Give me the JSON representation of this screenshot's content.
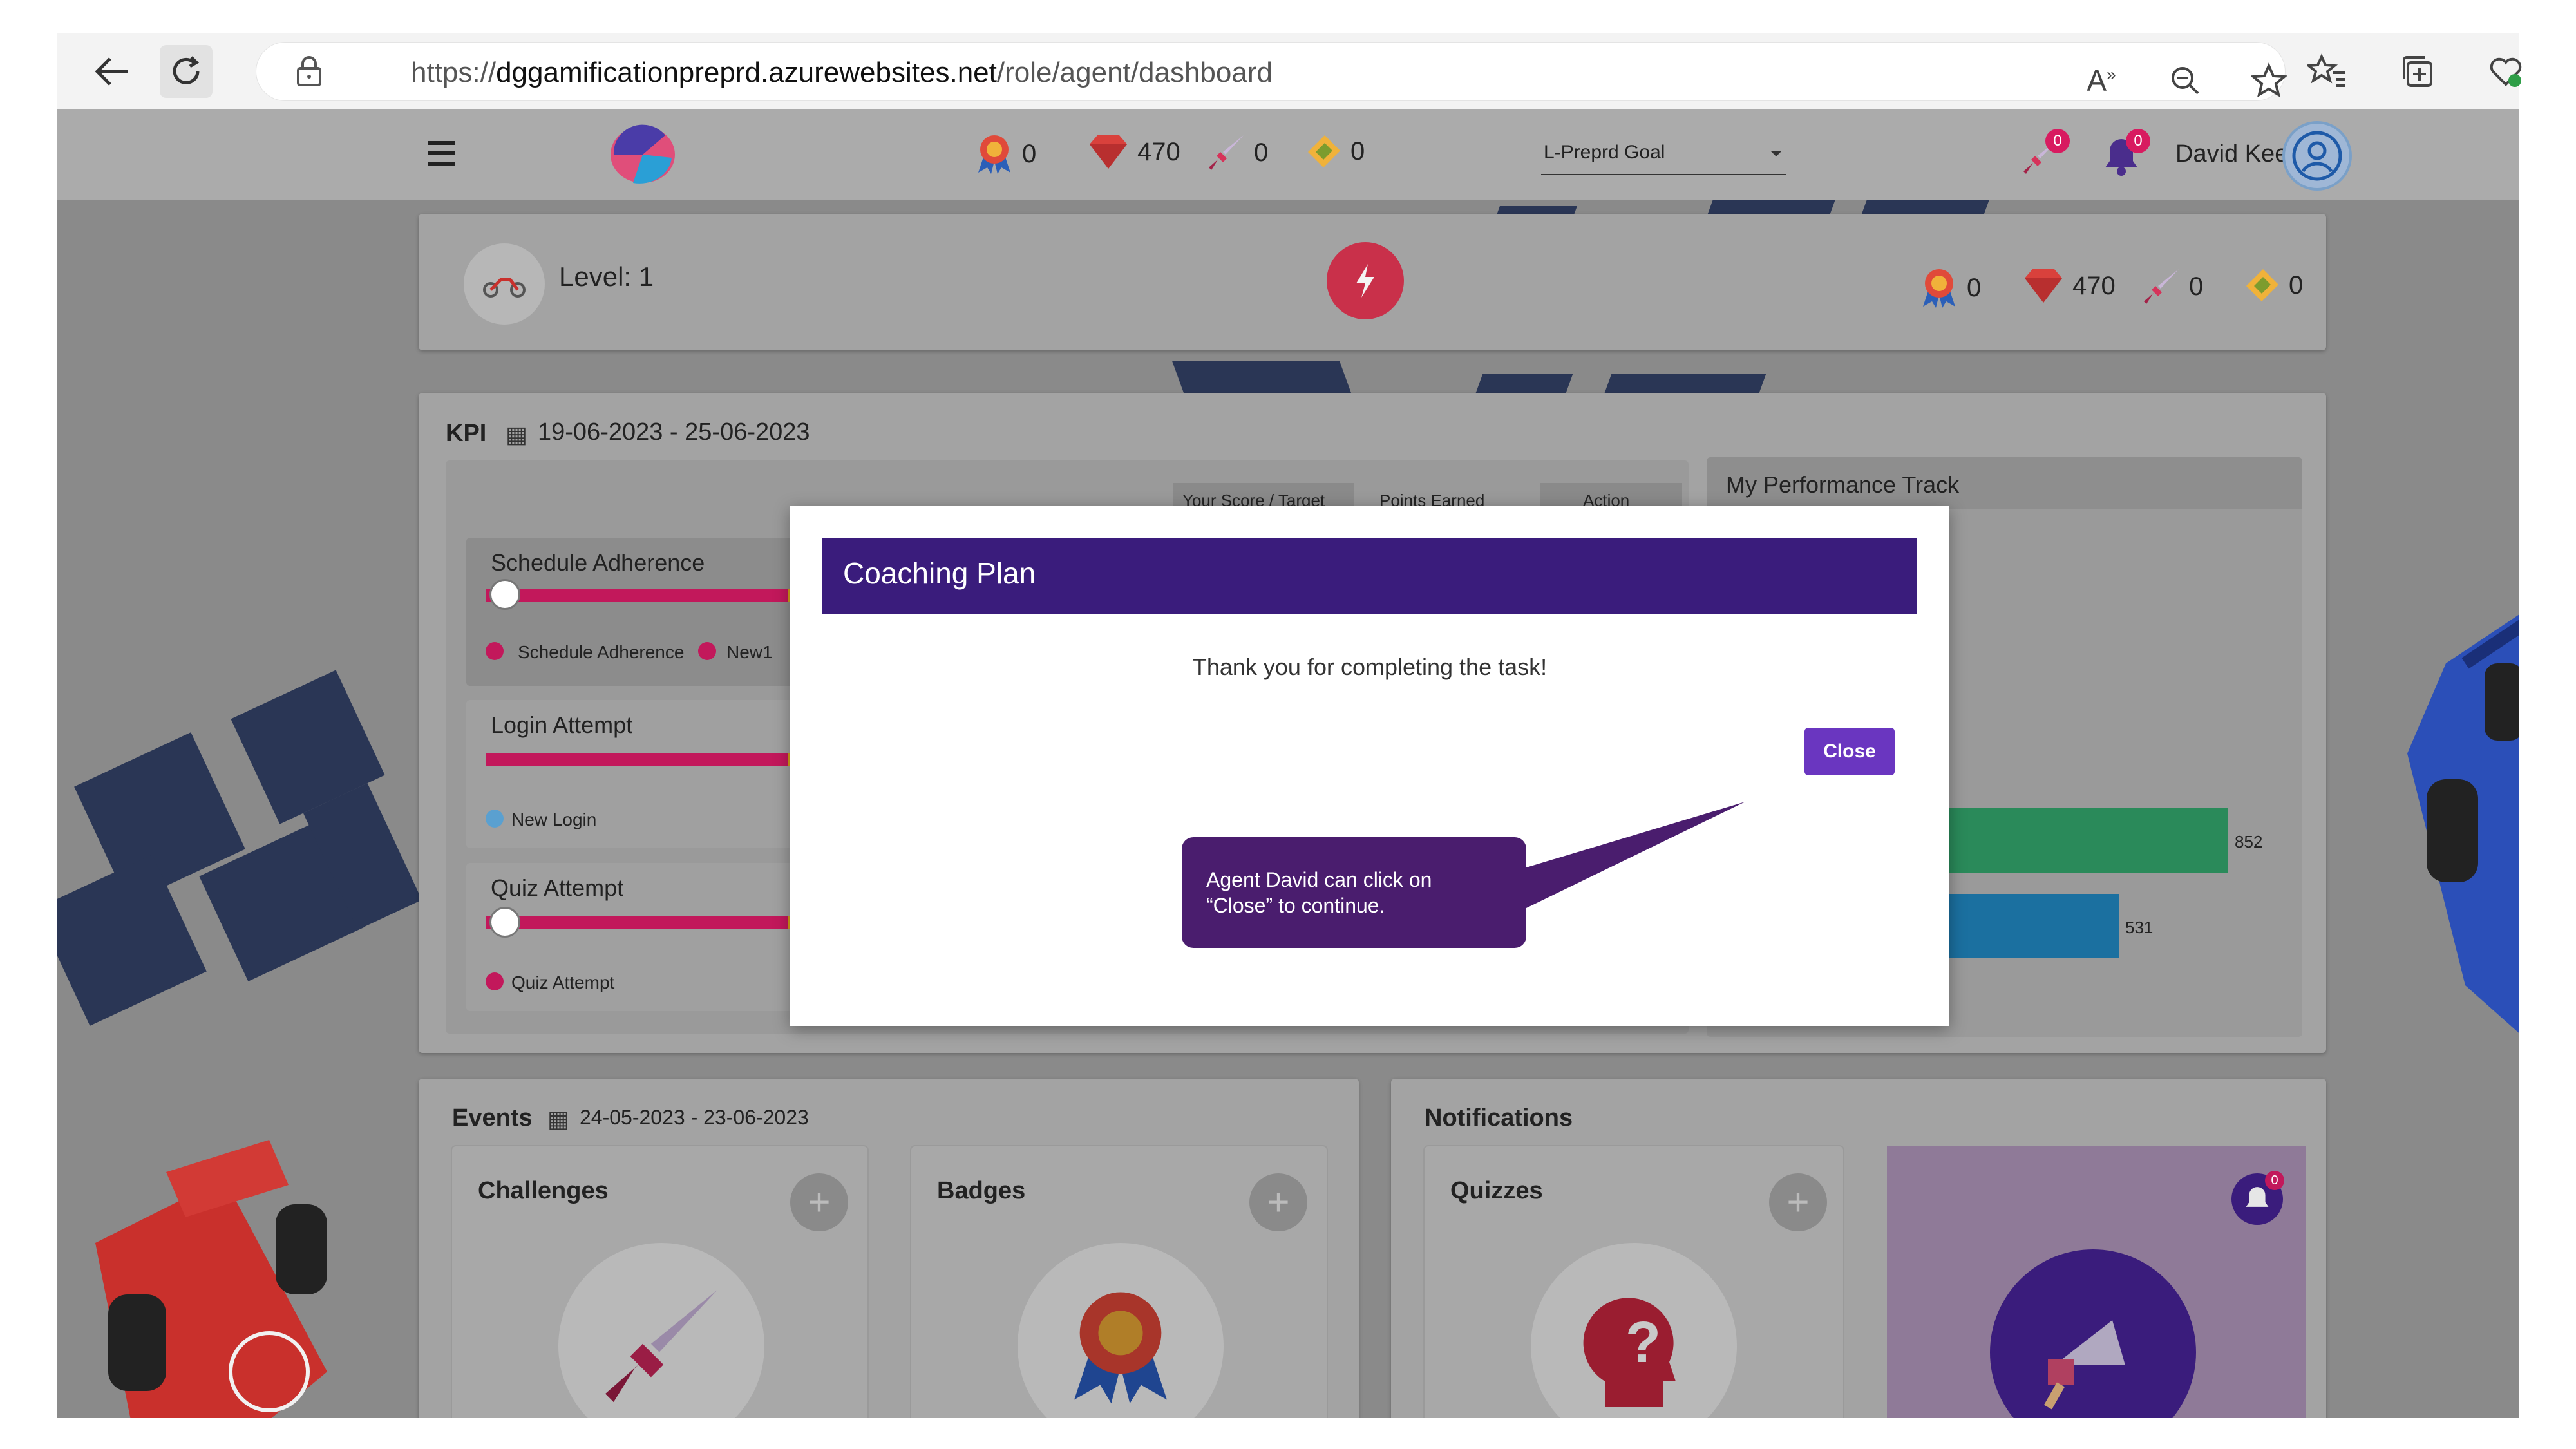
{
  "browser": {
    "url_prefix": "https://",
    "url_host": "dggamificationpreprd.azurewebsites.net",
    "url_path": "/role/agent/dashboard"
  },
  "header": {
    "stats": {
      "badges": "0",
      "gems": "470",
      "challenges": "0",
      "quizzes": "0"
    },
    "goal_select": "L-Preprd Goal",
    "user_name": "David Keel",
    "notification_counts": {
      "challenges": "0",
      "bell": "0"
    }
  },
  "level_card": {
    "level_label": "Level: 1",
    "stats": {
      "badges": "0",
      "gems": "470",
      "challenges": "0",
      "quizzes": "0"
    }
  },
  "kpi": {
    "title": "KPI",
    "date_range": "19-06-2023 - 25-06-2023",
    "table_headers": [
      "Your Score / Target",
      "Points Earned",
      "Action"
    ],
    "items": [
      {
        "name": "Schedule Adherence",
        "legend": [
          "Schedule Adherence",
          "New1"
        ]
      },
      {
        "name": "Login Attempt",
        "legend": [
          "New Login"
        ]
      },
      {
        "name": "Quiz Attempt",
        "legend": [
          "Quiz Attempt"
        ]
      }
    ]
  },
  "performance": {
    "title": "My Performance Track",
    "bar_values": [
      "852",
      "531"
    ]
  },
  "events": {
    "title": "Events",
    "date_range": "24-05-2023 - 23-06-2023",
    "challenges_label": "Challenges",
    "badges_label": "Badges"
  },
  "notifications": {
    "title": "Notifications",
    "quizzes_label": "Quizzes",
    "badge_count": "0"
  },
  "modal": {
    "title": "Coaching Plan",
    "message": "Thank you for completing the task!",
    "close_label": "Close"
  },
  "callout": {
    "line1": "Agent David can  click on",
    "line2": "“Close” to continue."
  },
  "colors": {
    "modal_header": "#3a1c7c",
    "close_button": "#6a36c0",
    "callout": "#4a1d6e",
    "kpi_bar": "#c2185b",
    "perf_green": "#2ea86d",
    "perf_blue": "#1e88c7"
  }
}
